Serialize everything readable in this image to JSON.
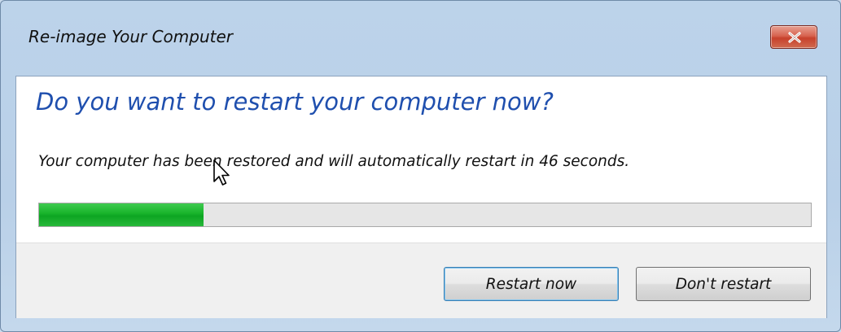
{
  "window": {
    "title": "Re-image Your Computer"
  },
  "dialog": {
    "heading": "Do you want to restart your computer now?",
    "message": "Your computer has been restored and will automatically restart in 46 seconds.",
    "progress_fraction": 0.213,
    "restart_now_label": "Restart now",
    "dont_restart_label": "Don't restart"
  },
  "colors": {
    "heading": "#1f4fae",
    "progress_fill": "#17b32a",
    "close_button": "#c7412c"
  },
  "icons": {
    "close": "close-icon",
    "cursor": "mouse-pointer-icon"
  }
}
